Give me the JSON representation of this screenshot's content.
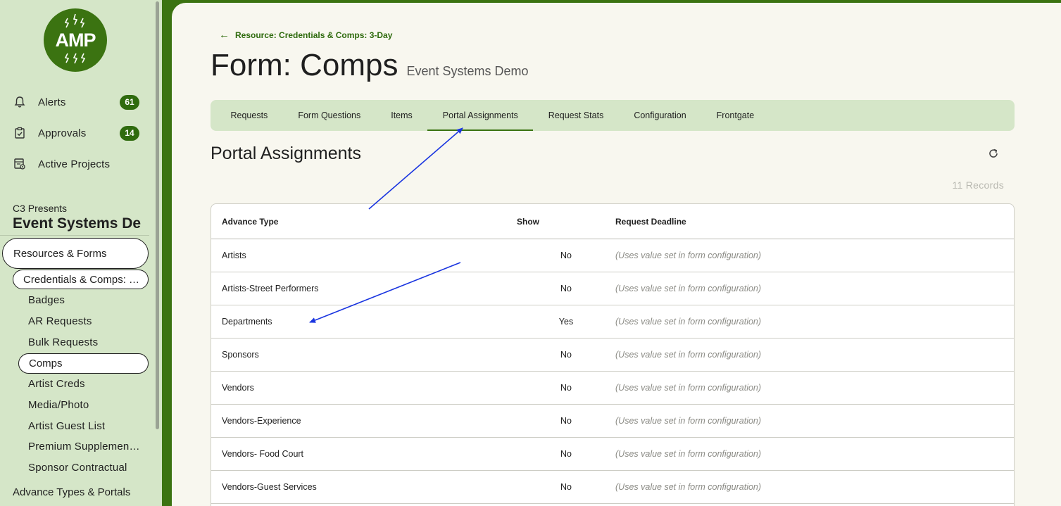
{
  "sidebar": {
    "logo_text": "AMP",
    "nav": [
      {
        "label": "Alerts",
        "badge": "61",
        "icon": "bell-icon"
      },
      {
        "label": "Approvals",
        "badge": "14",
        "icon": "clipboard-check-icon"
      },
      {
        "label": "Active Projects",
        "badge": "",
        "icon": "projects-icon"
      }
    ],
    "org": "C3 Presents",
    "project": "Event Systems De",
    "resources_label": "Resources & Forms",
    "resource_selected": "Credentials & Comps: …",
    "forms": [
      "Badges",
      "AR Requests",
      "Bulk Requests",
      "Comps",
      "Artist Creds",
      "Media/Photo",
      "Artist Guest List",
      "Premium Supplement…",
      "Sponsor Contractual"
    ],
    "bottom_label": "Advance Types & Portals"
  },
  "header": {
    "back_label": "Resource: Credentials & Comps: 3-Day",
    "title": "Form: Comps",
    "subtitle": "Event Systems Demo"
  },
  "tabs": [
    "Requests",
    "Form Questions",
    "Items",
    "Portal Assignments",
    "Request Stats",
    "Configuration",
    "Frontgate"
  ],
  "active_tab": "Portal Assignments",
  "section": {
    "title": "Portal Assignments",
    "records": "11 Records"
  },
  "table": {
    "headers": [
      "Advance Type",
      "Show",
      "Request Deadline"
    ],
    "rows": [
      {
        "type": "Artists",
        "show": "No",
        "deadline": "(Uses value set in form configuration)"
      },
      {
        "type": "Artists-Street Performers",
        "show": "No",
        "deadline": "(Uses value set in form configuration)"
      },
      {
        "type": "Departments",
        "show": "Yes",
        "deadline": "(Uses value set in form configuration)"
      },
      {
        "type": "Sponsors",
        "show": "No",
        "deadline": "(Uses value set in form configuration)"
      },
      {
        "type": "Vendors",
        "show": "No",
        "deadline": "(Uses value set in form configuration)"
      },
      {
        "type": "Vendors-Experience",
        "show": "No",
        "deadline": "(Uses value set in form configuration)"
      },
      {
        "type": "Vendors- Food Court",
        "show": "No",
        "deadline": "(Uses value set in form configuration)"
      },
      {
        "type": "Vendors-Guest Services",
        "show": "No",
        "deadline": "(Uses value set in form configuration)"
      }
    ]
  },
  "colors": {
    "brand_green": "#3b7311",
    "sidebar_bg": "#d5e6c8",
    "main_bg": "#f8f7ef",
    "annotation_arrow": "#1a35e0"
  }
}
